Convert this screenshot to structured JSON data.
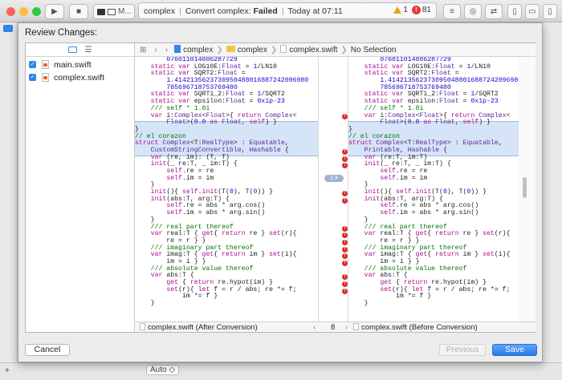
{
  "toolbar": {
    "scheme": "M...",
    "activity": {
      "project": "complex",
      "task": "Convert complex:",
      "status": "Failed",
      "time": "Today at 07:11",
      "warnings": "1",
      "errors": "81"
    }
  },
  "sheet": {
    "title": "Review Changes:",
    "files": [
      {
        "name": "main.swift",
        "checked": true
      },
      {
        "name": "complex.swift",
        "checked": true
      }
    ],
    "jumpbar": {
      "project": "complex",
      "group": "complex",
      "file": "complex.swift",
      "selection": "No Selection"
    },
    "change_count": "1",
    "left_code": [
      "        076011014886287729",
      "    static var LOG10E:Float = 1/LN10",
      "    static var SQRT2:Float =",
      "        1.4142135623730950488016887242096980",
      "        785696718753769480",
      "    static var SQRT1_2:Float = 1/SQRT2",
      "    static var epsilon:Float = 0x1p-23",
      "    /// self * 1.0i",
      "    var i:Complex<Float>{ return Complex<",
      "        Float>(0.0 as Float, self) }",
      "}",
      "// el corazon",
      "struct Complex<T:RealType> : Equatable,",
      "    CustomStringConvertible, Hashable {",
      "    var (re, im): (T, T)",
      "    init(_ re:T, _ im:T) {",
      "        self.re = re",
      "        self.im = im",
      "    }",
      "    init(){ self.init(T(0), T(0)) }",
      "    init(abs:T, arg:T) {",
      "        self.re = abs * arg.cos()",
      "        self.im = abs * arg.sin()",
      "    }",
      "    /// real part thereof",
      "    var real:T { get{ return re } set(r){",
      "        re = r } }",
      "    /// imaginary part thereof",
      "    var imag:T { get{ return im } set(i){",
      "        im = i } }",
      "    /// absolute value thereof",
      "    var abs:T {",
      "        get { return re.hypot(im) }",
      "        set(r){ let f = r / abs; re *= f;",
      "            im *= f }",
      "    }"
    ],
    "right_code": [
      "        076011014886287729",
      "    static var LOG10E:Float = 1/LN10",
      "    static var SQRT2:Float =",
      "        1.4142135623730950488016887242096980",
      "        785696718753769480",
      "    static var SQRT1_2:Float = 1/SQRT2",
      "    static var epsilon:Float = 0x1p-23",
      "    /// self * 1.0i",
      "    var i:Complex<Float>{ return Complex<",
      "        Float>(0.0 as Float, self) }",
      "}",
      "// el corazon",
      "struct Complex<T:RealType> : Equatable,",
      "    Printable, Hashable {",
      "    var (re:T, im:T)",
      "    init(_ re:T, _ im:T) {",
      "        self.re = re",
      "        self.im = im",
      "    }",
      "    init(){ self.init(T(0), T(0)) }",
      "    init(abs:T, arg:T) {",
      "        self.re = abs * arg.cos()",
      "        self.im = abs * arg.sin()",
      "    }",
      "    /// real part thereof",
      "    var real:T { get{ return re } set(r){",
      "        re = r } }",
      "    /// imaginary part thereof",
      "    var imag:T { get{ return im } set(i){",
      "        im = i } }",
      "    /// absolute value thereof",
      "    var abs:T {",
      "        get { return re.hypot(im) }",
      "        set(r){ let f = r / abs; re *= f;",
      "            im *= f }",
      "    }"
    ],
    "footer": {
      "left": "complex.swift (After Conversion)",
      "counter": "8",
      "right": "complex.swift (Before Conversion)"
    },
    "buttons": {
      "cancel": "Cancel",
      "previous": "Previous",
      "save": "Save"
    }
  },
  "bottom": {
    "zoom": "Auto"
  }
}
